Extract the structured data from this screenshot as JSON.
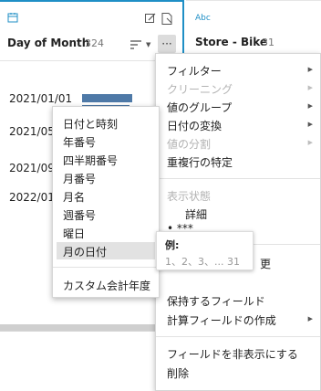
{
  "left_field": {
    "name": "Day of Month",
    "count": "324",
    "more_label": "···",
    "rows": [
      "2021/01/01",
      "2021/05",
      "2021/09",
      "2022/01"
    ]
  },
  "right_field": {
    "type_label": "Abc",
    "name": "Store - Bike",
    "count": "31"
  },
  "context_menu": {
    "filter": "フィルター",
    "cleaning": "クリーニング",
    "value_group": "値のグループ",
    "date_convert": "日付の変換",
    "value_split": "値の分割",
    "identify_duplicates": "重複行の特定",
    "display_state": "表示状態",
    "detail": "詳細",
    "partial_1": "•  ***",
    "partial_2": "更",
    "keep_fields": "保持するフィールド",
    "create_calc": "計算フィールドの作成",
    "hide_field": "フィールドを非表示にする",
    "delete": "削除"
  },
  "submenu": {
    "items": [
      "日付と時刻",
      "年番号",
      "四半期番号",
      "月番号",
      "月名",
      "週番号",
      "曜日",
      "月の日付"
    ],
    "custom_fiscal": "カスタム会計年度"
  },
  "tooltip": {
    "title": "例:",
    "text": "1、2、3、... 31"
  },
  "colors": {
    "bar": "#4e79a7",
    "accent": "#1f8fc6"
  }
}
